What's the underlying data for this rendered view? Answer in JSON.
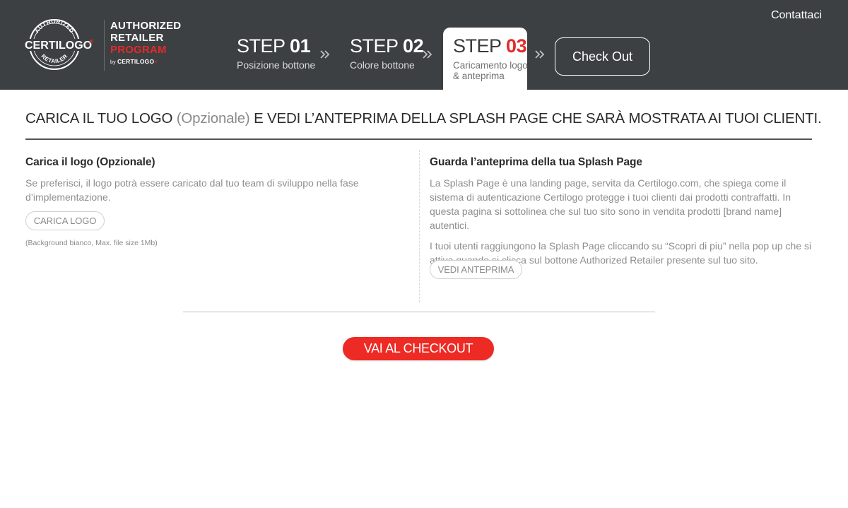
{
  "brand": {
    "badge_top": "AUTHORIZED",
    "badge_main": "CERTILOGO",
    "badge_bottom": "RETAILER",
    "program_line1": "AUTHORIZED",
    "program_line2": "RETAILER",
    "program_line3": "PROGRAM",
    "by_text": "by",
    "by_brand": "CERTILOGO"
  },
  "header": {
    "contact_label": "Contattaci",
    "checkout_label": "Check Out"
  },
  "steps": [
    {
      "word": "STEP",
      "number": "01",
      "caption": "Posizione bottone",
      "active": false
    },
    {
      "word": "STEP",
      "number": "02",
      "caption": "Colore bottone",
      "active": false
    },
    {
      "word": "STEP",
      "number": "03",
      "caption_line1": "Caricamento logo",
      "caption_line2": "& anteprima",
      "active": true
    }
  ],
  "main": {
    "heading_part1": "CARICA IL TUO LOGO",
    "heading_optional": "(Opzionale)",
    "heading_part2": "E VEDI L’ANTEPRIMA DELLA SPLASH PAGE CHE SARÀ MOSTRATA AI TUOI CLIENTI.",
    "left": {
      "title": "Carica il logo (Opzionale)",
      "text": "Se preferisci, il logo potrà essere caricato dal tuo team di sviluppo nella fase d’implementazione.",
      "button_label": "CARICA LOGO",
      "note": "(Background bianco, Max. file size 1Mb)"
    },
    "right": {
      "title": "Guarda l’anteprima della tua Splash Page",
      "paragraph1": "La Splash Page è una landing page, servita da Certilogo.com, che spiega come il sistema di autenticazione Certilogo protegge i tuoi clienti dai prodotti contraffatti. In questa pagina si sottolinea che sul tuo sito sono in vendita prodotti [brand name] autentici.",
      "paragraph2": "I tuoi utenti raggiungono la Splash Page cliccando su “Scopri di piu” nella pop up che si attiva quando si clicca sul bottone Authorized Retailer presente sul tuo sito.",
      "button_label": "VEDI ANTEPRIMA"
    },
    "checkout_label": "VAI AL CHECKOUT"
  },
  "colors": {
    "header_bg": "#3d4042",
    "accent_red": "#e32a2a",
    "checkout_red": "#ee2a24"
  }
}
